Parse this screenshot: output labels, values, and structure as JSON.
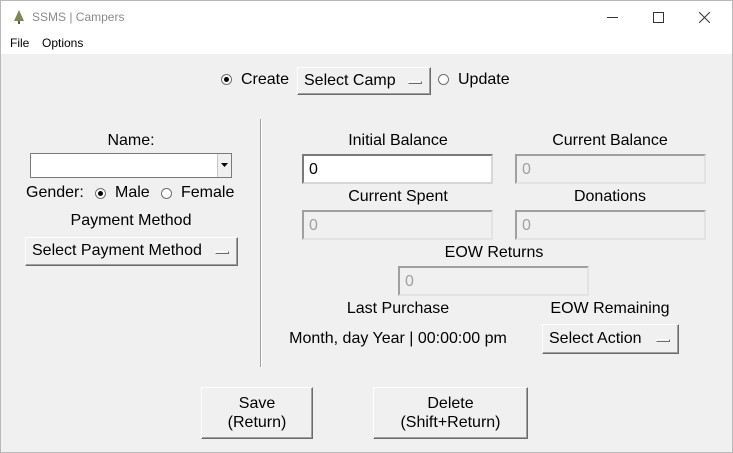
{
  "window": {
    "title": "SSMS | Campers",
    "controls": [
      "minimize-icon",
      "maximize-icon",
      "close-icon"
    ]
  },
  "menu": {
    "file": "File",
    "options": "Options"
  },
  "top": {
    "create_label": "Create",
    "update_label": "Update",
    "mode_selected": "Create",
    "camp_select": "Select Camp"
  },
  "left": {
    "name_label": "Name:",
    "name_value": "",
    "gender_label": "Gender:",
    "male_label": "Male",
    "female_label": "Female",
    "gender_selected": "Male",
    "payment_label": "Payment Method",
    "payment_select": "Select Payment Method"
  },
  "right": {
    "initial_balance_label": "Initial Balance",
    "initial_balance_value": "0",
    "current_balance_label": "Current Balance",
    "current_balance_value": "0",
    "current_spent_label": "Current Spent",
    "current_spent_value": "0",
    "donations_label": "Donations",
    "donations_value": "0",
    "eow_returns_label": "EOW Returns",
    "eow_returns_value": "0",
    "last_purchase_label": "Last Purchase",
    "last_purchase_value": "Month, day Year | 00:00:00 pm",
    "eow_remaining_label": "EOW Remaining",
    "eow_action_select": "Select Action"
  },
  "buttons": {
    "save_line1": "Save",
    "save_line2": "(Return)",
    "delete_line1": "Delete",
    "delete_line2": "(Shift+Return)"
  }
}
